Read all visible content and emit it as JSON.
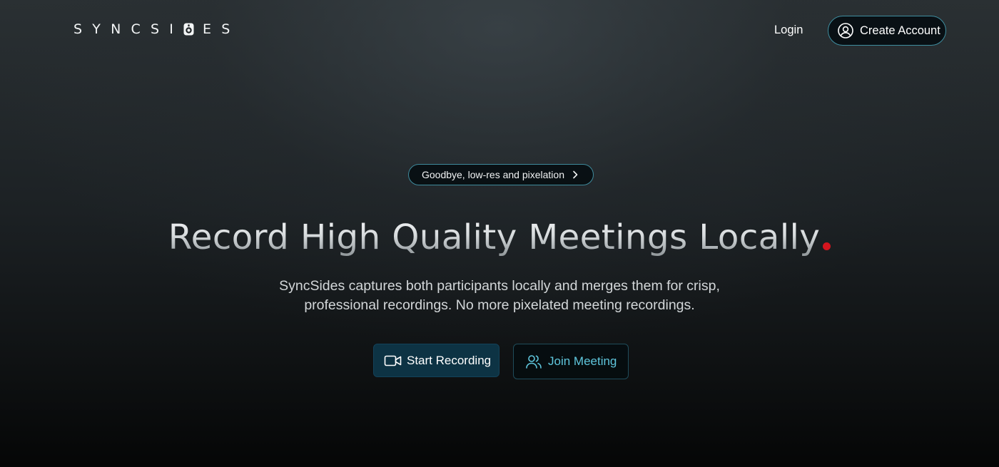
{
  "header": {
    "logo": {
      "text_left": "SYNCSI",
      "text_right": "ES",
      "mark_icon": "record-knob-icon"
    },
    "nav": {
      "login_label": "Login",
      "create_account_label": "Create Account",
      "create_account_icon": "user-circle-icon"
    }
  },
  "hero": {
    "badge": {
      "label": "Goodbye, low-res and pixelation",
      "icon": "chevron-right-icon"
    },
    "headline": "Record High Quality Meetings Locally",
    "subtitle_line1": "SyncSides captures both participants locally and merges them for crisp,",
    "subtitle_line2": "professional recordings. No more pixelated meeting recordings.",
    "actions": {
      "start_recording_label": "Start Recording",
      "start_recording_icon": "video-camera-icon",
      "join_meeting_label": "Join Meeting",
      "join_meeting_icon": "users-icon"
    }
  },
  "colors": {
    "accent_cyan": "#5fc6dd",
    "border_teal": "#3f8ea0",
    "primary_button": "#0d3344",
    "headline_dot_red": "#d4151e"
  }
}
